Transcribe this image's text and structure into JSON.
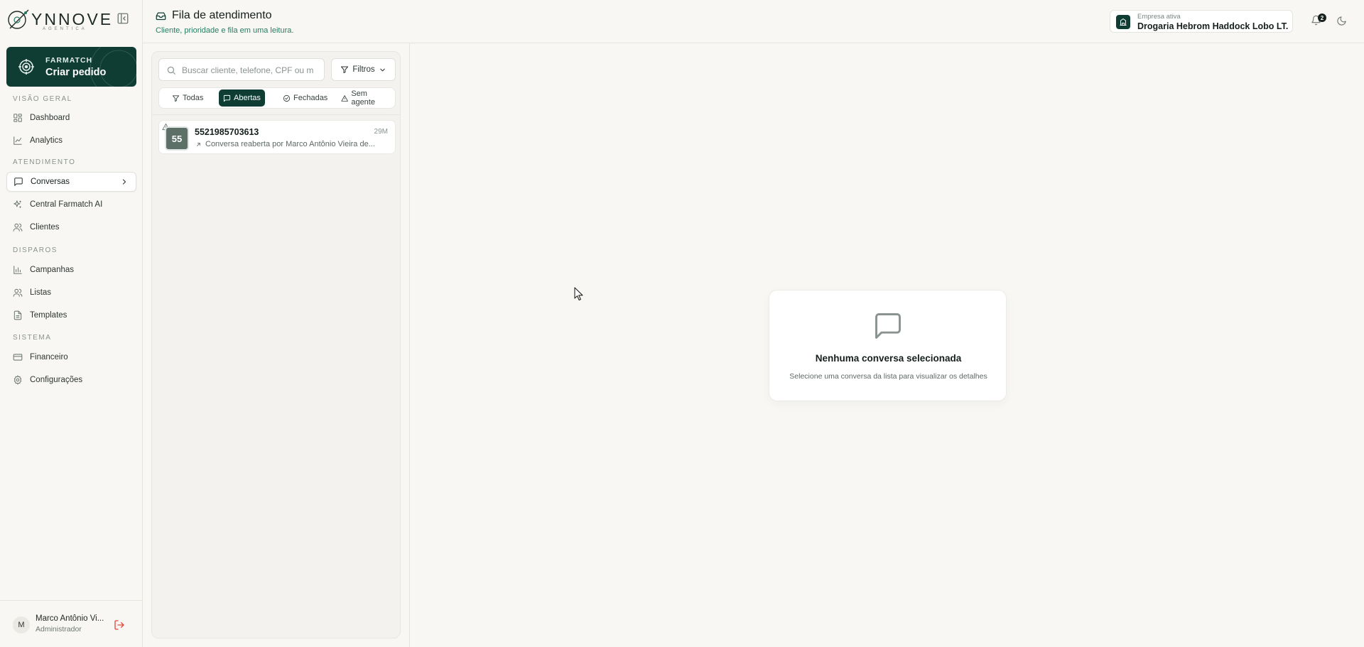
{
  "brand": {
    "logo_text": "YNNOVE",
    "logo_sub": "AGENTICA"
  },
  "sidebar": {
    "cta": {
      "eyebrow": "FARMATCH",
      "title": "Criar pedido"
    },
    "sections": {
      "overview": "VISÃO GERAL",
      "service": "ATENDIMENTO",
      "dispatch": "DISPAROS",
      "system": "SISTEMA"
    },
    "items": [
      {
        "label": "Dashboard",
        "icon": "dashboard-icon"
      },
      {
        "label": "Analytics",
        "icon": "chart-line-icon"
      },
      {
        "label": "Conversas",
        "icon": "message-square-icon",
        "active": true
      },
      {
        "label": "Central Farmatch AI",
        "icon": "sparkles-icon"
      },
      {
        "label": "Clientes",
        "icon": "users-icon"
      },
      {
        "label": "Campanhas",
        "icon": "bar-chart-icon"
      },
      {
        "label": "Listas",
        "icon": "users-icon"
      },
      {
        "label": "Templates",
        "icon": "file-text-icon"
      },
      {
        "label": "Financeiro",
        "icon": "credit-card-icon"
      },
      {
        "label": "Configurações",
        "icon": "gear-icon"
      }
    ],
    "user": {
      "initial": "M",
      "name": "Marco Antônio Vi...",
      "role": "Administrador"
    }
  },
  "header": {
    "title": "Fila de atendimento",
    "subtitle": "Cliente, prioridade e fila em uma leitura.",
    "company_label": "Empresa ativa",
    "company_name": "Drogaria Hebrom Haddock Lobo LT...",
    "notification_count": "2"
  },
  "queue": {
    "search_placeholder": "Buscar cliente, telefone, CPF ou m",
    "filters_label": "Filtros",
    "tabs": [
      {
        "label": "Todas",
        "icon": "filter-icon"
      },
      {
        "label": "Abertas",
        "icon": "message-square-icon",
        "active": true
      },
      {
        "label": "Fechadas",
        "icon": "check-circle-icon"
      },
      {
        "label": "Sem agente",
        "icon": "alert-triangle-icon"
      }
    ],
    "conversations": [
      {
        "avatar": "55",
        "phone": "5521985703613",
        "time": "29M",
        "preview": "Conversa reaberta por Marco Antônio Vieira de..."
      }
    ]
  },
  "empty_state": {
    "title": "Nenhuma conversa selecionada",
    "subtitle": "Selecione uma conversa da lista para visualizar os detalhes"
  },
  "colors": {
    "brand": "#0f3d33",
    "accent_text": "#2a7a63",
    "background": "#f8f7f4",
    "danger": "#e0483c"
  }
}
